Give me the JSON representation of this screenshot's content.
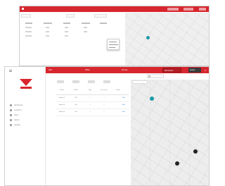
{
  "front": {
    "sidebar": {
      "items": [
        {
          "label": "Dashboard",
          "icon": "dashboard-icon"
        },
        {
          "label": "Locations",
          "icon": "location-icon"
        },
        {
          "label": "Users",
          "icon": "users-icon"
        },
        {
          "label": "Alarms",
          "icon": "alarm-icon"
        },
        {
          "label": "Settings",
          "icon": "gear-icon"
        }
      ]
    },
    "topbar": {
      "site_label": "Site",
      "filter_label": "Filter",
      "group_label": "Group",
      "primary_action": "Add device",
      "secondary_action": "Export",
      "close_symbol": "×"
    },
    "table": {
      "columns": [
        "Name",
        "Status",
        "Type",
        "Last seen",
        "Value"
      ],
      "rows": [
        [
          "Device 1",
          "OK",
          "—",
          "—",
          "—"
        ],
        [
          "Device 2",
          "OK",
          "—",
          "—",
          "—"
        ],
        [
          "Device 3",
          "OK",
          "—",
          "—",
          "—"
        ]
      ],
      "action_label": "Edit"
    },
    "map": {
      "markers": [
        {
          "color": "teal",
          "label": "1"
        },
        {
          "color": "dark",
          "label": "2"
        },
        {
          "color": "dark",
          "label": "3"
        }
      ]
    }
  },
  "colors": {
    "brand_red": "#d7262e",
    "teal_marker": "#1a9aa6",
    "dark_marker": "#222222"
  }
}
